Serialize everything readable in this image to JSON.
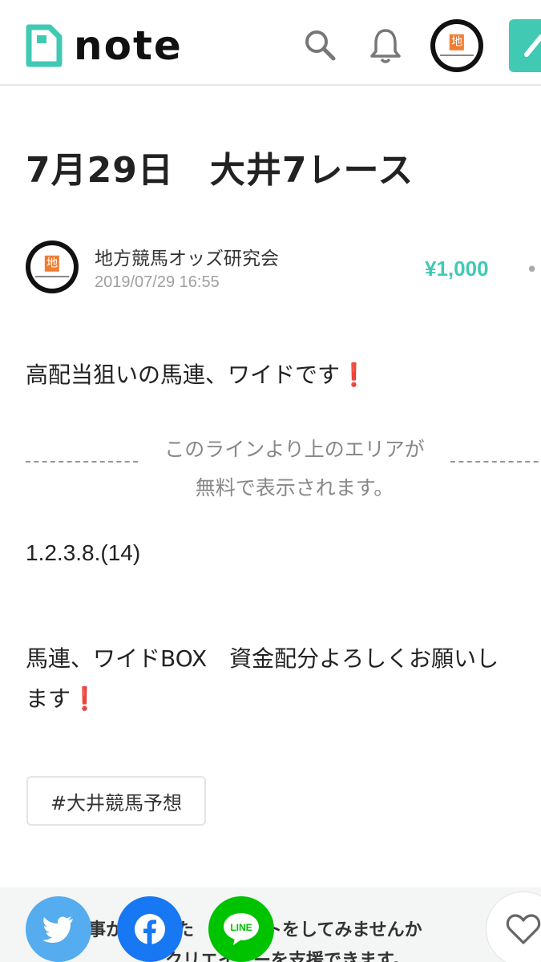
{
  "header": {
    "logo_text": "note",
    "avatar_glyph": "地",
    "icons": [
      "note-logo-icon",
      "search-icon",
      "bell-icon",
      "pencil-icon"
    ]
  },
  "article": {
    "title": "7月29日　大井7レース",
    "author": {
      "name": "地方競馬オッズ研究会",
      "avatar_glyph": "地",
      "posted_at": "2019/07/29 16:55"
    },
    "price": "¥1,000",
    "more_label": "••",
    "intro": "高配当狙いの馬連、ワイドです",
    "intro_mark": "❗",
    "free_divider_line1": "このラインより上のエリアが",
    "free_divider_line2": "無料で表示されます。",
    "numbers": "1.2.3.8.(14)",
    "para_line1": "馬連、ワイドBOX　資金配分よろしくお願いし",
    "para_line2": "ます",
    "para_mark": "❗",
    "hashtag": "#大井競馬予想"
  },
  "support": {
    "line1": "事か　　った　　ポートをしてみませんか",
    "line2": "クリエイ　ーを支援できます。"
  },
  "share": {
    "line_label": "LINE"
  },
  "colors": {
    "accent": "#41c9b4",
    "twitter": "#55acee",
    "facebook": "#1877f2",
    "line": "#00c300",
    "excl": "#dd2020"
  }
}
